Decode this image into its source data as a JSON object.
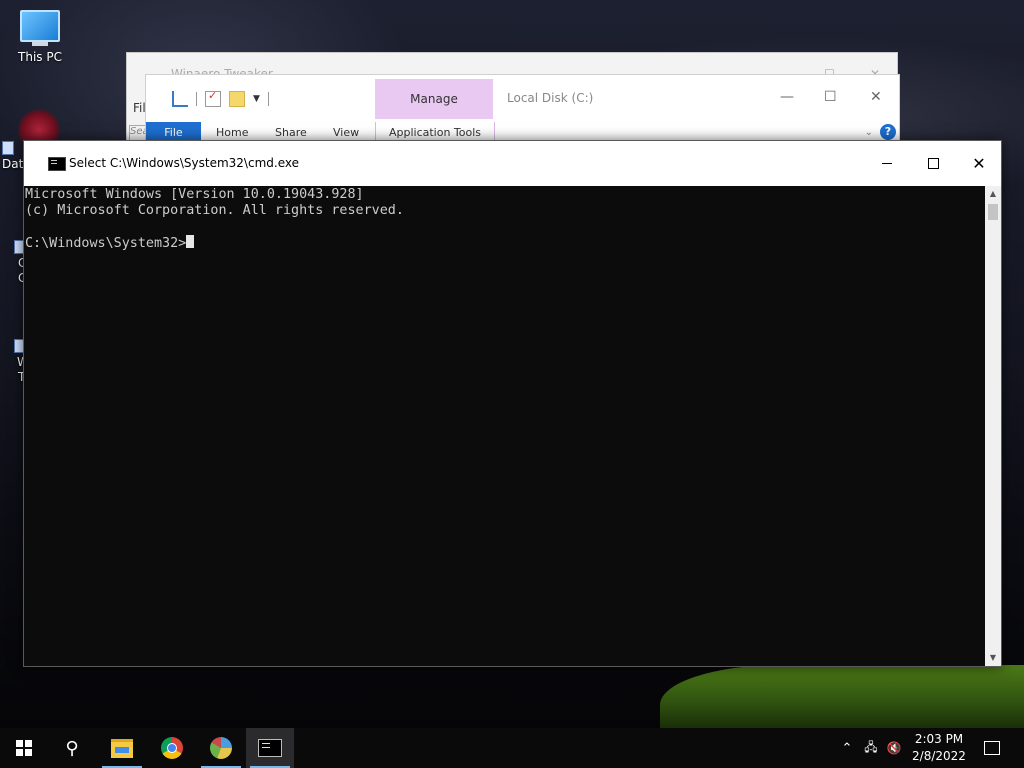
{
  "desktop": {
    "this_pc_label": "This PC",
    "partial_label_1": "Data",
    "partial_label_2": "C",
    "partial_label_3": "C",
    "partial_label_4": "W",
    "partial_label_5": "T"
  },
  "tweaker_window": {
    "title": "Winaero Tweaker",
    "menu_file": "Fil",
    "search_hint": "Sea"
  },
  "explorer_window": {
    "manage_tab": "Manage",
    "title": "Local Disk (C:)",
    "tabs": [
      "File",
      "Home",
      "Share",
      "View"
    ],
    "context_tab": "Application Tools",
    "help": "?"
  },
  "cmd_window": {
    "title": "Select C:\\Windows\\System32\\cmd.exe",
    "lines": [
      "Microsoft Windows [Version 10.0.19043.928]",
      "(c) Microsoft Corporation. All rights reserved.",
      "",
      "C:\\Windows\\System32>"
    ]
  },
  "taskbar": {
    "time": "2:03 PM",
    "date": "2/8/2022",
    "pinned": [
      "start",
      "search",
      "file-explorer",
      "chrome",
      "winaero-tweaker",
      "command-prompt"
    ]
  }
}
